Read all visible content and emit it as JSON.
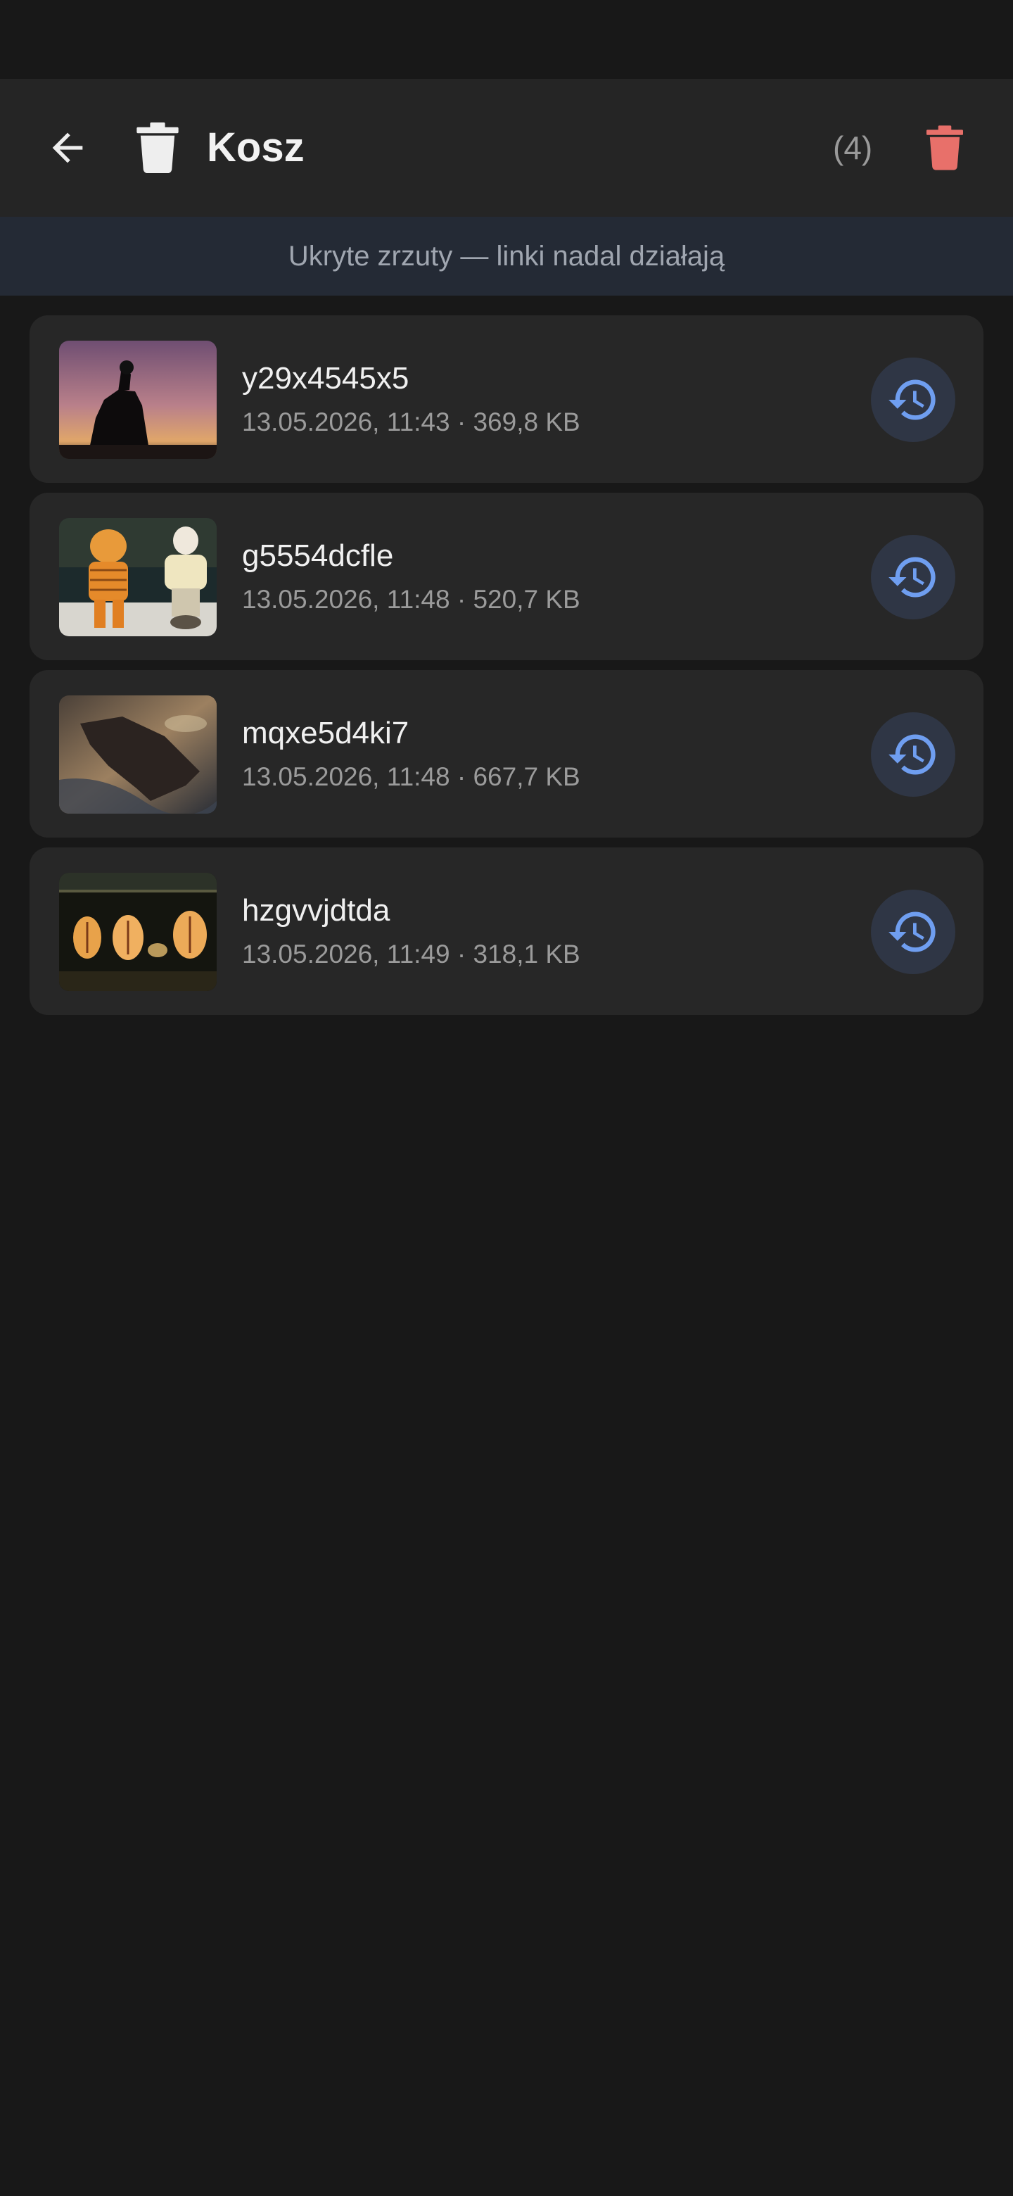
{
  "app_bar": {
    "title": "Kosz",
    "count": "(4)",
    "icons": {
      "back": "arrow-back-icon",
      "title": "trash-icon",
      "empty": "delete-all-icon"
    },
    "colors": {
      "danger": "#e8706a"
    }
  },
  "banner": {
    "text": "Ukryte zrzuty — linki nadal działają"
  },
  "items": [
    {
      "name": "y29x4545x5",
      "meta": "13.05.2026, 11:43 · 369,8 KB",
      "thumb": "sunset-rock-photo"
    },
    {
      "name": "g5554dcfle",
      "meta": "13.05.2026, 11:48 · 520,7 KB",
      "thumb": "astronaut-figures-photo"
    },
    {
      "name": "mqxe5d4ki7",
      "meta": "13.05.2026, 11:48 · 667,7 KB",
      "thumb": "island-sea-photo"
    },
    {
      "name": "hzgvvjdtda",
      "meta": "13.05.2026, 11:49 · 318,1 KB",
      "thumb": "paper-lanterns-photo"
    }
  ],
  "restore_icon": "restore-history-icon",
  "accent": "#6f9ef0"
}
